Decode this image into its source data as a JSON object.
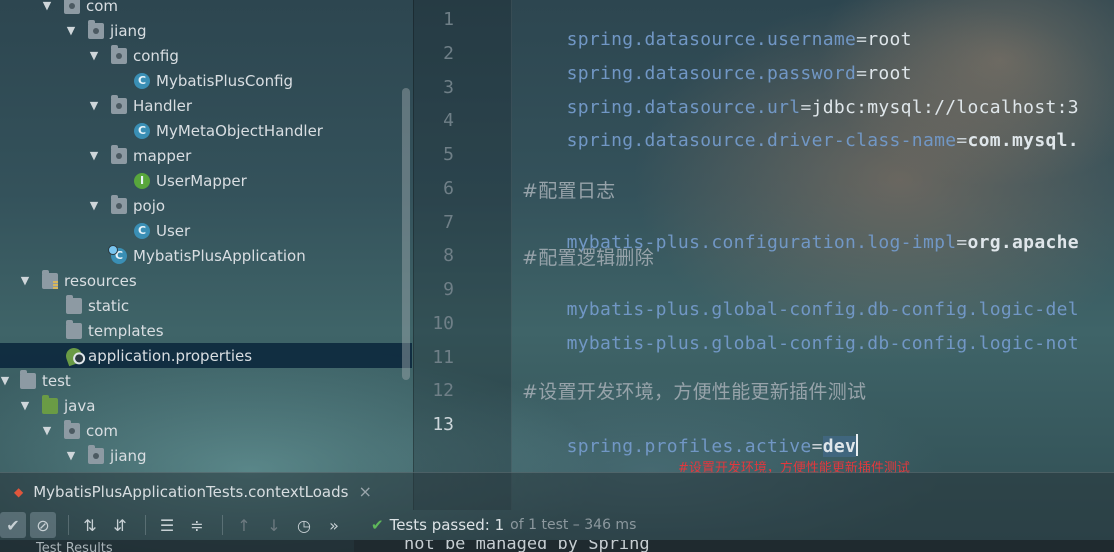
{
  "project_tree": {
    "items": [
      {
        "label": "com",
        "type": "package",
        "depth": 2,
        "expanded": true
      },
      {
        "label": "jiang",
        "type": "package",
        "depth": 3,
        "expanded": true
      },
      {
        "label": "config",
        "type": "package",
        "depth": 4,
        "expanded": true
      },
      {
        "label": "MybatisPlusConfig",
        "type": "class",
        "depth": 5
      },
      {
        "label": "Handler",
        "type": "package",
        "depth": 4,
        "expanded": true
      },
      {
        "label": "MyMetaObjectHandler",
        "type": "class",
        "depth": 5
      },
      {
        "label": "mapper",
        "type": "package",
        "depth": 4,
        "expanded": true
      },
      {
        "label": "UserMapper",
        "type": "interface",
        "depth": 5
      },
      {
        "label": "pojo",
        "type": "package",
        "depth": 4,
        "expanded": true
      },
      {
        "label": "User",
        "type": "class",
        "depth": 5
      },
      {
        "label": "MybatisPlusApplication",
        "type": "app",
        "depth": 4
      },
      {
        "label": "resources",
        "type": "resources",
        "depth": 1,
        "expanded": true
      },
      {
        "label": "static",
        "type": "folder",
        "depth": 2
      },
      {
        "label": "templates",
        "type": "folder",
        "depth": 2
      },
      {
        "label": "application.properties",
        "type": "properties",
        "depth": 2,
        "selected": true
      },
      {
        "label": "test",
        "type": "folder",
        "depth": 0,
        "expanded": true
      },
      {
        "label": "java",
        "type": "source",
        "depth": 1,
        "expanded": true
      },
      {
        "label": "com",
        "type": "package",
        "depth": 2,
        "expanded": true
      },
      {
        "label": "jiang",
        "type": "package",
        "depth": 3,
        "expanded": true
      }
    ]
  },
  "editor": {
    "line_numbers": [
      "1",
      "2",
      "3",
      "4",
      "5",
      "6",
      "7",
      "8",
      "9",
      "10",
      "11",
      "12",
      "13"
    ],
    "active_line": "13",
    "lines": [
      {
        "key": "spring.datasource.username",
        "eq": "=",
        "value": "root"
      },
      {
        "key": "spring.datasource.password",
        "eq": "=",
        "value": "root"
      },
      {
        "key": "spring.datasource.url",
        "eq": "=",
        "value": "jdbc:mysql://localhost:3"
      },
      {
        "key": "spring.datasource.driver-class-name",
        "eq": "=",
        "value": "com.mysql."
      },
      {
        "blank": true
      },
      {
        "comment": "#配置日志"
      },
      {
        "key": "mybatis-plus.configuration.log-impl",
        "eq": "=",
        "value": "org.apache"
      },
      {
        "comment": "#配置逻辑删除"
      },
      {
        "key": "mybatis-plus.global-config.db-config.logic-del",
        "eq": "",
        "value": ""
      },
      {
        "key": "mybatis-plus.global-config.db-config.logic-not",
        "eq": "",
        "value": ""
      },
      {
        "blank": true
      },
      {
        "comment": "#设置开发环境，方便性能更新插件测试"
      },
      {
        "key": "spring.profiles.active",
        "eq": "=",
        "value": "dev"
      }
    ],
    "annotation": "#设置开发环境，方便性能更新插件测试"
  },
  "run_panel": {
    "tab_label": "MybatisPlusApplicationTests.contextLoads",
    "close": "×",
    "status_passed": "Tests passed: 1",
    "status_of": "of 1 test – 346 ms",
    "results_stub": "Test Results",
    "console_stub": "not be managed by Spring"
  }
}
